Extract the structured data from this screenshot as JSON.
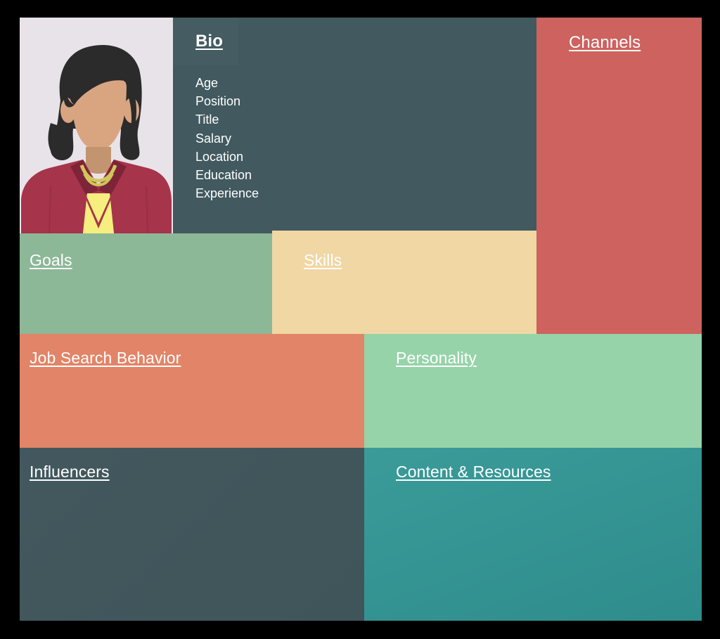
{
  "document": {
    "kind": "persona-template",
    "canvas_background": "#000000"
  },
  "avatar": {
    "name": "persona-portrait-illustration",
    "background_color": "#E8E3E8",
    "hair_color": "#2B2B2B",
    "skin_color": "#D9A581",
    "skin_shadow_color": "#C29470",
    "blazer_color": "#A6344B",
    "blazer_dark_color": "#7E2438",
    "shirt_color": "#F6EE7E",
    "necklace_color": "#CFC75A"
  },
  "panels": {
    "bio": {
      "title": "Bio",
      "background_color": "#41595F",
      "fields": [
        "Age",
        "Position",
        "Title",
        "Salary",
        "Location",
        "Education",
        "Experience"
      ]
    },
    "channels": {
      "title": "Channels",
      "background_color": "#CD625E"
    },
    "goals": {
      "title": "Goals",
      "background_color": "#8CB898"
    },
    "skills": {
      "title": "Skills",
      "background_color": "#F0D7A4"
    },
    "job_search_behavior": {
      "title": "Job Search Behavior",
      "background_color": "#E28467"
    },
    "personality": {
      "title": "Personality",
      "background_color": "#96D3A9"
    },
    "influencers": {
      "title": "Influencers",
      "background_color": "#42585E"
    },
    "content_resources": {
      "title": "Content & Resources",
      "background_color": "#3A9B99"
    }
  }
}
